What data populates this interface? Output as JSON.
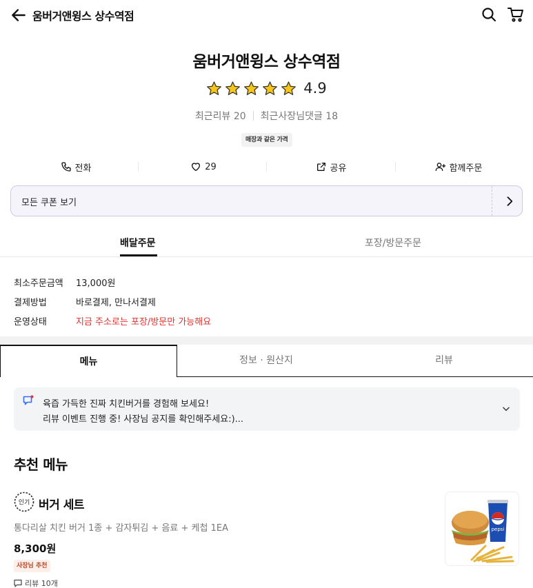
{
  "topbar": {
    "title": "움버거앤윙스 상수역점",
    "back_icon": "arrow-left-icon",
    "search_icon": "search-icon",
    "cart_icon": "cart-icon"
  },
  "store": {
    "name": "움버거앤윙스 상수역점",
    "rating": "4.9",
    "star_count": 5,
    "star_color": "#f5c518",
    "recent_reviews": "최근리뷰 20",
    "owner_replies": "최근사장님댓글 18",
    "price_badge": "매장과 같은 가격"
  },
  "actions": {
    "call": "전화",
    "likes": "29",
    "share": "공유",
    "group_order": "함께주문"
  },
  "coupon": {
    "label": "모든 쿠폰 보기"
  },
  "order_tabs": [
    {
      "label": "배달주문",
      "active": true
    },
    {
      "label": "포장/방문주문",
      "active": false
    }
  ],
  "info": [
    {
      "label": "최소주문금액",
      "value": "13,000원"
    },
    {
      "label": "결제방법",
      "value": "바로결제, 만나서결제"
    },
    {
      "label": "운영상태",
      "value": "지금 주소로는 포장/방문만 가능해요"
    }
  ],
  "menu_tabs": [
    {
      "label": "메뉴",
      "active": true
    },
    {
      "label": "정보 · 원산지",
      "active": false
    },
    {
      "label": "리뷰",
      "active": false
    }
  ],
  "notice": {
    "line1": "육즙 가득한 진짜 치킨버거를 경험해 보세요!",
    "line2": "리뷰 이벤트 진행 중! 사장님 공지를 확인해주세요:)..."
  },
  "section_title": "추천 메뉴",
  "item": {
    "badge": "인기",
    "name": "버거 세트",
    "desc": "통다리살 치킨 버거 1종 + 감자튀김 + 음료 + 케첩 1EA",
    "price": "8,300원",
    "tag": "사장님 추천",
    "review": "리뷰 10개",
    "image_label": "pepsi"
  },
  "colors": {
    "accent_purple": "#cfc6ee",
    "warning_red": "#e5302e"
  }
}
